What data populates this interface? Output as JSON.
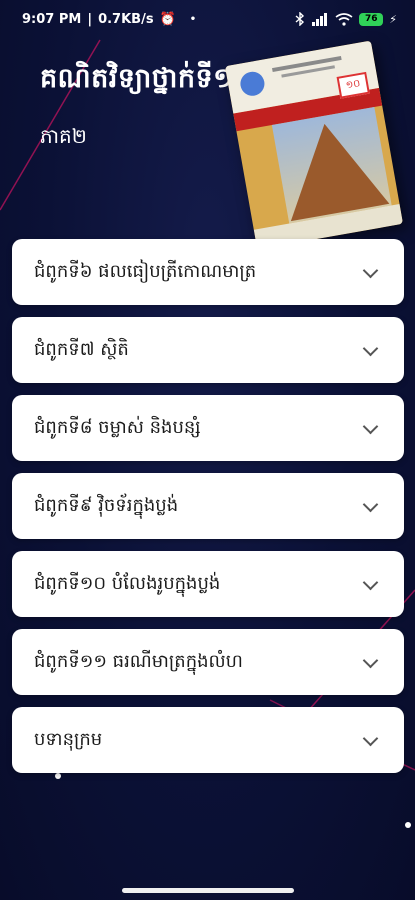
{
  "status": {
    "time": "9:07 PM",
    "speed": "0.7KB/s",
    "alarm_icon": "⏰",
    "dot": "•",
    "battery": "76"
  },
  "header": {
    "title": "គណិតវិទ្យាថ្នាក់ទី១០",
    "subtitle": "ភាគ២"
  },
  "book_cover": {
    "badge": "១០"
  },
  "menu": {
    "items": [
      {
        "label": "ជំពូកទី៦ ផលធៀបត្រីកោណមាត្រ"
      },
      {
        "label": "ជំពូកទី៧ ស្ថិតិ"
      },
      {
        "label": "ជំពូកទី៨ ចម្លាស់ និងបន្សំ"
      },
      {
        "label": "ជំពូកទី៩ វ៉ិចទ័រក្នុងប្លង់"
      },
      {
        "label": "ជំពូកទី១០ បំលែងរូបក្នុងប្លង់"
      },
      {
        "label": "ជំពូកទី១១ ធរណីមាត្រក្នុងលំហ"
      },
      {
        "label": "បទានុក្រម"
      }
    ]
  },
  "colors": {
    "background": "#0b1136",
    "card": "#ffffff",
    "accent_line": "#c2185b",
    "battery": "#30d158"
  }
}
